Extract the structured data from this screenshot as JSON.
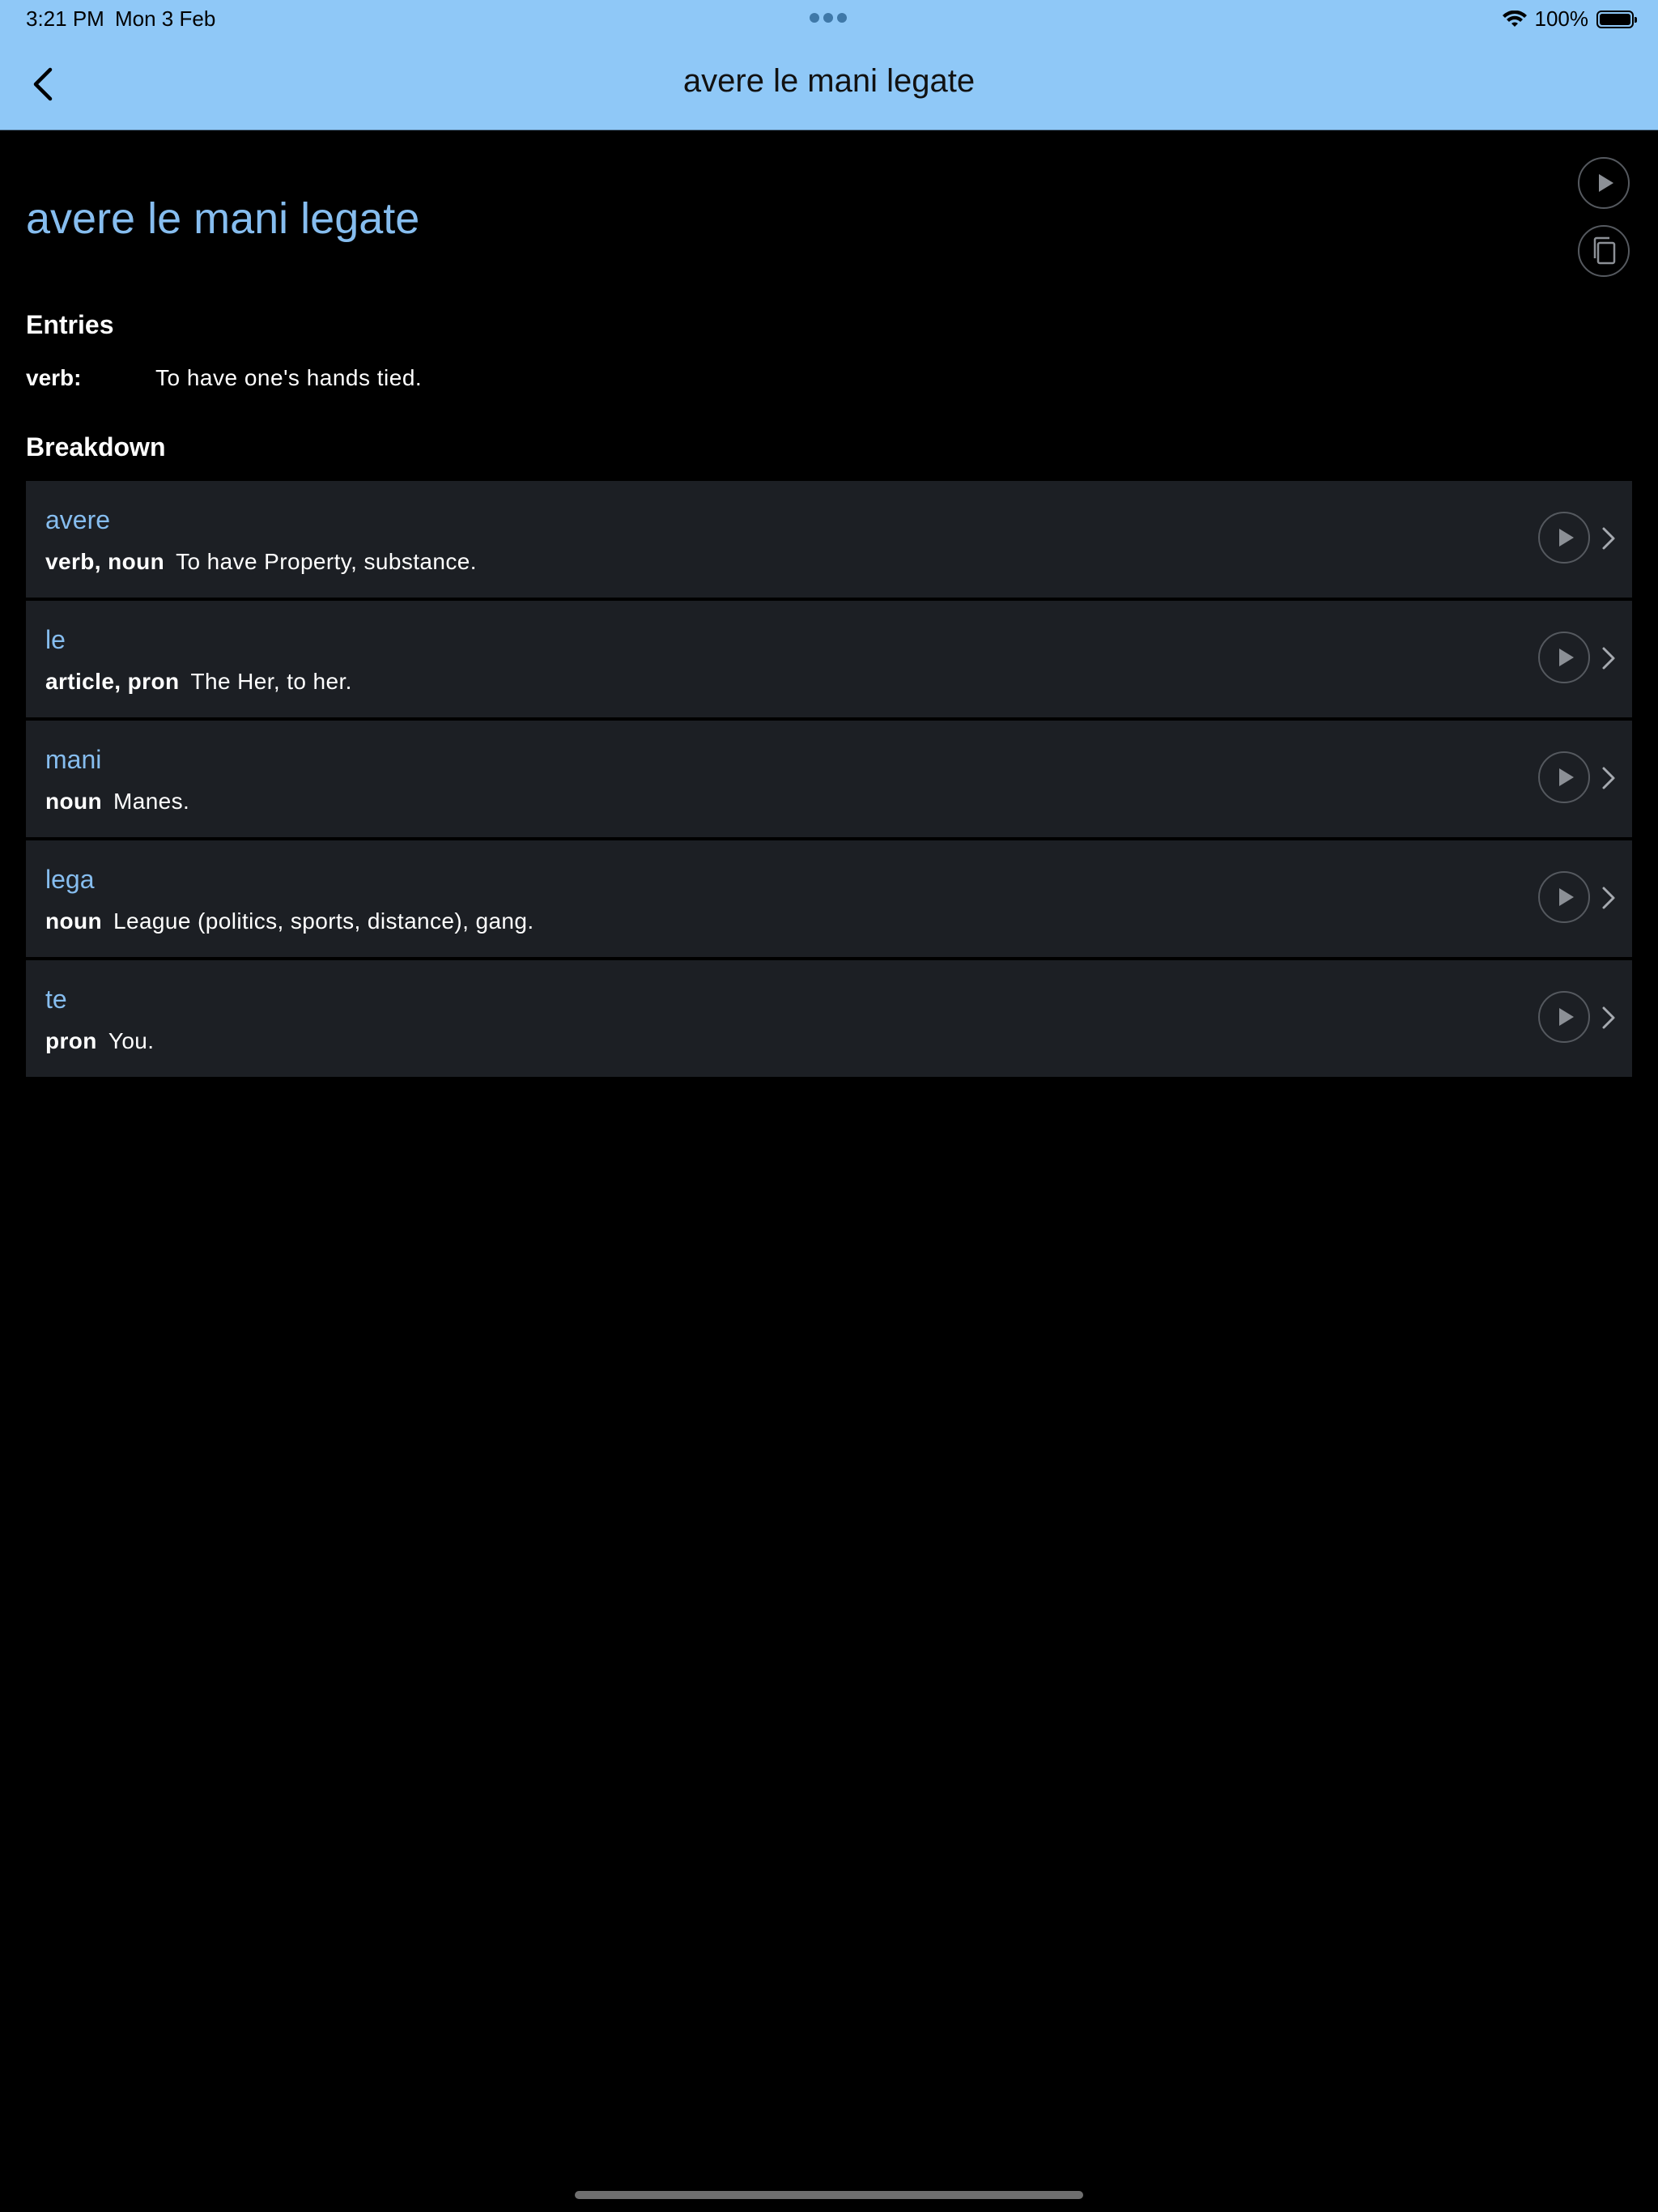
{
  "status": {
    "time": "3:21 PM",
    "date": "Mon 3 Feb",
    "battery": "100%",
    "battery_level": 1.0
  },
  "nav": {
    "title": "avere le mani legate",
    "back_icon": "chevron-left-icon"
  },
  "word": {
    "title": "avere le mani legate",
    "play_icon": "play-icon",
    "copy_icon": "copy-icon"
  },
  "entries": {
    "heading": "Entries",
    "items": [
      {
        "pos": "verb:",
        "definition": "To have one's hands tied."
      }
    ]
  },
  "breakdown": {
    "heading": "Breakdown",
    "items": [
      {
        "word": "avere",
        "pos": "verb, noun",
        "definition": "To have Property, substance."
      },
      {
        "word": "le",
        "pos": "article, pron",
        "definition": "The Her, to her."
      },
      {
        "word": "mani",
        "pos": "noun",
        "definition": "Manes."
      },
      {
        "word": "lega",
        "pos": "noun",
        "definition": "League (politics, sports, distance), gang."
      },
      {
        "word": "te",
        "pos": "pron",
        "definition": "You."
      }
    ]
  },
  "colors": {
    "header_bg": "#8fc8f7",
    "accent_text": "#86bdef",
    "row_bg": "#1c1f24",
    "page_bg": "#000000"
  }
}
